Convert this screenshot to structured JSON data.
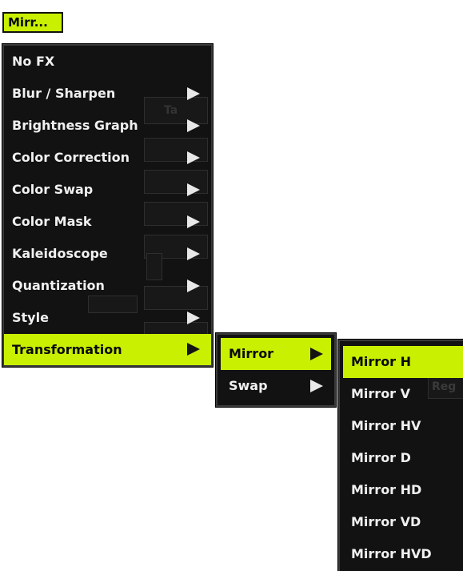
{
  "trigger": {
    "label": "Mirr..."
  },
  "main_menu": {
    "items": [
      {
        "label": "No FX"
      },
      {
        "label": "Blur / Sharpen"
      },
      {
        "label": "Brightness Graph"
      },
      {
        "label": "Color Correction"
      },
      {
        "label": "Color Swap"
      },
      {
        "label": "Color Mask"
      },
      {
        "label": "Kaleidoscope"
      },
      {
        "label": "Quantization"
      },
      {
        "label": "Style"
      },
      {
        "label": "Transformation"
      }
    ]
  },
  "transformation_menu": {
    "items": [
      {
        "label": "Mirror"
      },
      {
        "label": "Swap"
      }
    ]
  },
  "mirror_menu": {
    "items": [
      {
        "label": "Mirror H"
      },
      {
        "label": "Mirror V"
      },
      {
        "label": "Mirror HV"
      },
      {
        "label": "Mirror D"
      },
      {
        "label": "Mirror HD"
      },
      {
        "label": "Mirror VD"
      },
      {
        "label": "Mirror HVD"
      }
    ]
  },
  "background_hints": {
    "tab_fragment": "Ta",
    "reg_fragment": "Reg"
  },
  "colors": {
    "accent": "#c8f000",
    "menu_bg": "#121212",
    "menu_text": "#f0f0f0"
  }
}
